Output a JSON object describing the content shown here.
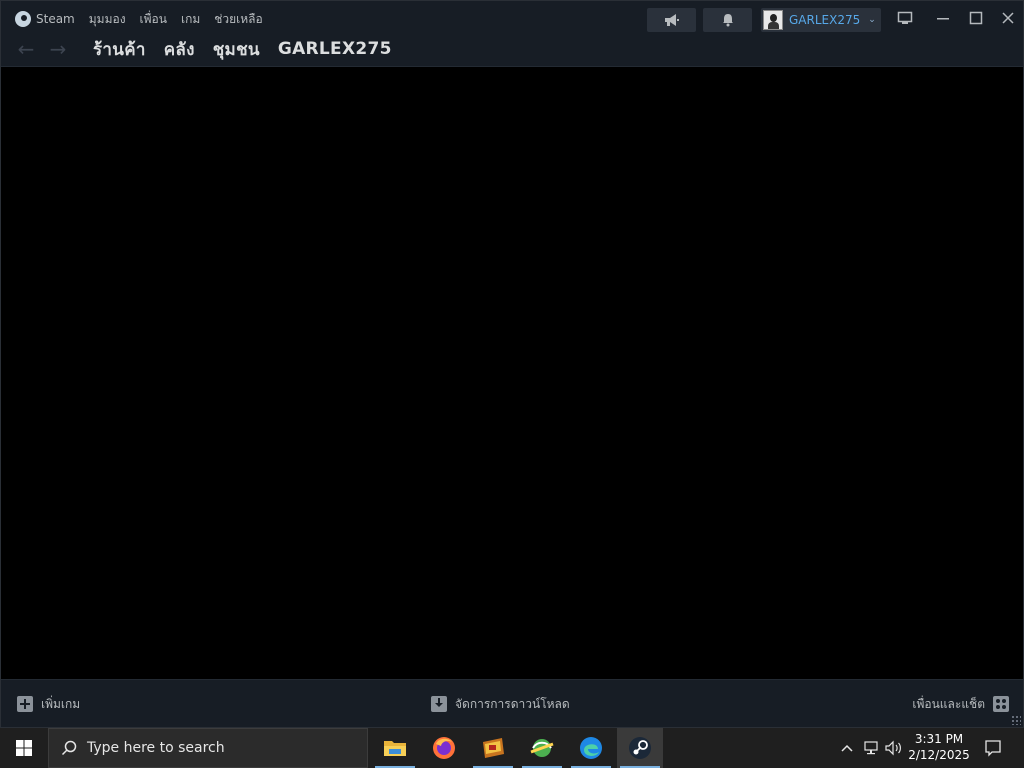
{
  "menu": {
    "steam": "Steam",
    "view": "มุมมอง",
    "friends": "เพื่อน",
    "games": "เกม",
    "help": "ช่วยเหลือ"
  },
  "nav": {
    "tabs": [
      "ร้านค้า",
      "คลัง",
      "ชุมชน",
      "GARLEX275"
    ]
  },
  "account": {
    "username": "GARLEX275"
  },
  "bottombar": {
    "add_game": "เพิ่มเกม",
    "manage_downloads": "จัดการการดาวน์โหลด",
    "friends_chat": "เพื่อนและแช็ต"
  },
  "taskbar": {
    "search_placeholder": "Type here to search",
    "apps": [
      "file-explorer",
      "firefox",
      "game-app",
      "network-app",
      "edge",
      "steam"
    ],
    "time": "3:31 PM",
    "date": "2/12/2025"
  },
  "colors": {
    "titlebar_bg": "#171d25",
    "accent_blue": "#57a8e8",
    "taskbar_bg": "#1f1f1f"
  }
}
